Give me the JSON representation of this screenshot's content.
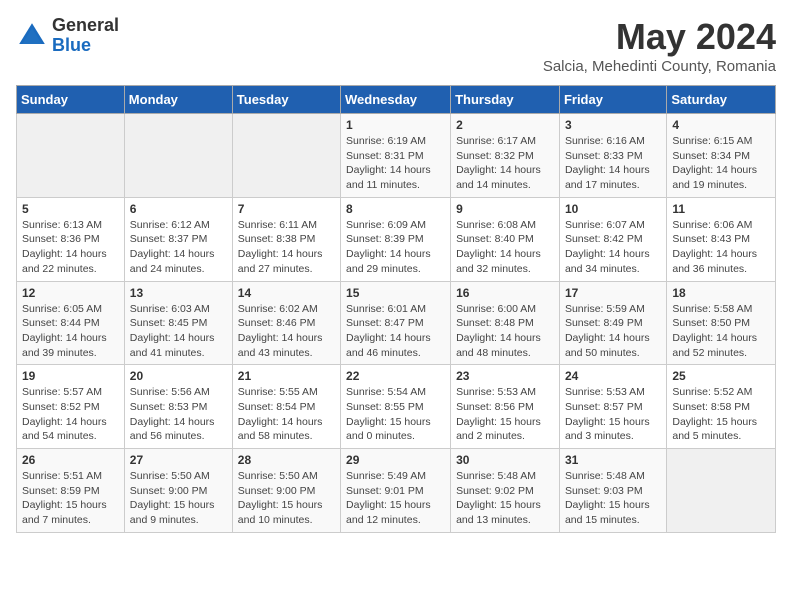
{
  "logo": {
    "general": "General",
    "blue": "Blue"
  },
  "title": "May 2024",
  "subtitle": "Salcia, Mehedinti County, Romania",
  "days_of_week": [
    "Sunday",
    "Monday",
    "Tuesday",
    "Wednesday",
    "Thursday",
    "Friday",
    "Saturday"
  ],
  "weeks": [
    [
      {
        "day": "",
        "info": ""
      },
      {
        "day": "",
        "info": ""
      },
      {
        "day": "",
        "info": ""
      },
      {
        "day": "1",
        "info": "Sunrise: 6:19 AM\nSunset: 8:31 PM\nDaylight: 14 hours\nand 11 minutes."
      },
      {
        "day": "2",
        "info": "Sunrise: 6:17 AM\nSunset: 8:32 PM\nDaylight: 14 hours\nand 14 minutes."
      },
      {
        "day": "3",
        "info": "Sunrise: 6:16 AM\nSunset: 8:33 PM\nDaylight: 14 hours\nand 17 minutes."
      },
      {
        "day": "4",
        "info": "Sunrise: 6:15 AM\nSunset: 8:34 PM\nDaylight: 14 hours\nand 19 minutes."
      }
    ],
    [
      {
        "day": "5",
        "info": "Sunrise: 6:13 AM\nSunset: 8:36 PM\nDaylight: 14 hours\nand 22 minutes."
      },
      {
        "day": "6",
        "info": "Sunrise: 6:12 AM\nSunset: 8:37 PM\nDaylight: 14 hours\nand 24 minutes."
      },
      {
        "day": "7",
        "info": "Sunrise: 6:11 AM\nSunset: 8:38 PM\nDaylight: 14 hours\nand 27 minutes."
      },
      {
        "day": "8",
        "info": "Sunrise: 6:09 AM\nSunset: 8:39 PM\nDaylight: 14 hours\nand 29 minutes."
      },
      {
        "day": "9",
        "info": "Sunrise: 6:08 AM\nSunset: 8:40 PM\nDaylight: 14 hours\nand 32 minutes."
      },
      {
        "day": "10",
        "info": "Sunrise: 6:07 AM\nSunset: 8:42 PM\nDaylight: 14 hours\nand 34 minutes."
      },
      {
        "day": "11",
        "info": "Sunrise: 6:06 AM\nSunset: 8:43 PM\nDaylight: 14 hours\nand 36 minutes."
      }
    ],
    [
      {
        "day": "12",
        "info": "Sunrise: 6:05 AM\nSunset: 8:44 PM\nDaylight: 14 hours\nand 39 minutes."
      },
      {
        "day": "13",
        "info": "Sunrise: 6:03 AM\nSunset: 8:45 PM\nDaylight: 14 hours\nand 41 minutes."
      },
      {
        "day": "14",
        "info": "Sunrise: 6:02 AM\nSunset: 8:46 PM\nDaylight: 14 hours\nand 43 minutes."
      },
      {
        "day": "15",
        "info": "Sunrise: 6:01 AM\nSunset: 8:47 PM\nDaylight: 14 hours\nand 46 minutes."
      },
      {
        "day": "16",
        "info": "Sunrise: 6:00 AM\nSunset: 8:48 PM\nDaylight: 14 hours\nand 48 minutes."
      },
      {
        "day": "17",
        "info": "Sunrise: 5:59 AM\nSunset: 8:49 PM\nDaylight: 14 hours\nand 50 minutes."
      },
      {
        "day": "18",
        "info": "Sunrise: 5:58 AM\nSunset: 8:50 PM\nDaylight: 14 hours\nand 52 minutes."
      }
    ],
    [
      {
        "day": "19",
        "info": "Sunrise: 5:57 AM\nSunset: 8:52 PM\nDaylight: 14 hours\nand 54 minutes."
      },
      {
        "day": "20",
        "info": "Sunrise: 5:56 AM\nSunset: 8:53 PM\nDaylight: 14 hours\nand 56 minutes."
      },
      {
        "day": "21",
        "info": "Sunrise: 5:55 AM\nSunset: 8:54 PM\nDaylight: 14 hours\nand 58 minutes."
      },
      {
        "day": "22",
        "info": "Sunrise: 5:54 AM\nSunset: 8:55 PM\nDaylight: 15 hours\nand 0 minutes."
      },
      {
        "day": "23",
        "info": "Sunrise: 5:53 AM\nSunset: 8:56 PM\nDaylight: 15 hours\nand 2 minutes."
      },
      {
        "day": "24",
        "info": "Sunrise: 5:53 AM\nSunset: 8:57 PM\nDaylight: 15 hours\nand 3 minutes."
      },
      {
        "day": "25",
        "info": "Sunrise: 5:52 AM\nSunset: 8:58 PM\nDaylight: 15 hours\nand 5 minutes."
      }
    ],
    [
      {
        "day": "26",
        "info": "Sunrise: 5:51 AM\nSunset: 8:59 PM\nDaylight: 15 hours\nand 7 minutes."
      },
      {
        "day": "27",
        "info": "Sunrise: 5:50 AM\nSunset: 9:00 PM\nDaylight: 15 hours\nand 9 minutes."
      },
      {
        "day": "28",
        "info": "Sunrise: 5:50 AM\nSunset: 9:00 PM\nDaylight: 15 hours\nand 10 minutes."
      },
      {
        "day": "29",
        "info": "Sunrise: 5:49 AM\nSunset: 9:01 PM\nDaylight: 15 hours\nand 12 minutes."
      },
      {
        "day": "30",
        "info": "Sunrise: 5:48 AM\nSunset: 9:02 PM\nDaylight: 15 hours\nand 13 minutes."
      },
      {
        "day": "31",
        "info": "Sunrise: 5:48 AM\nSunset: 9:03 PM\nDaylight: 15 hours\nand 15 minutes."
      },
      {
        "day": "",
        "info": ""
      }
    ]
  ]
}
